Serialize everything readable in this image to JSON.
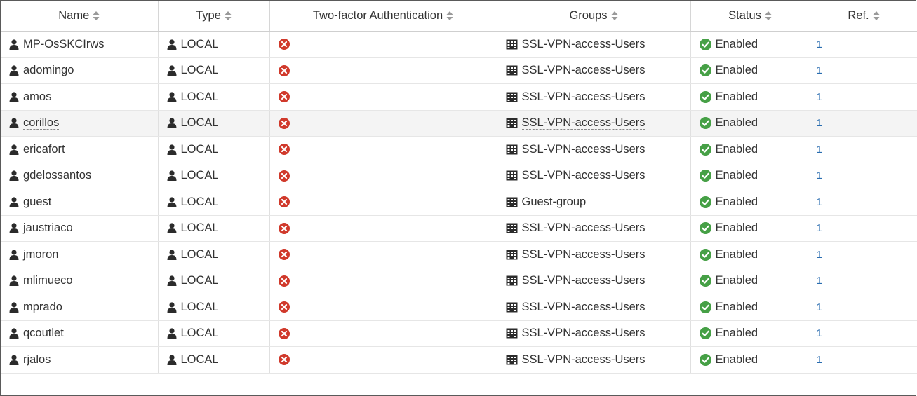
{
  "columns": [
    {
      "label": "Name"
    },
    {
      "label": "Type"
    },
    {
      "label": "Two-factor Authentication"
    },
    {
      "label": "Groups"
    },
    {
      "label": "Status"
    },
    {
      "label": "Ref."
    }
  ],
  "icons": {
    "user": "user-icon",
    "tfa_disabled": "x-circle-icon",
    "group": "group-icon",
    "enabled": "check-circle-icon"
  },
  "colors": {
    "error": "#d0392b",
    "success": "#46a046",
    "link": "#2a6db0"
  },
  "rows": [
    {
      "name": "MP-OsSKCIrws",
      "type": "LOCAL",
      "group": "SSL-VPN-access-Users",
      "status": "Enabled",
      "ref": "1"
    },
    {
      "name": "adomingo",
      "type": "LOCAL",
      "group": "SSL-VPN-access-Users",
      "status": "Enabled",
      "ref": "1"
    },
    {
      "name": "amos",
      "type": "LOCAL",
      "group": "SSL-VPN-access-Users",
      "status": "Enabled",
      "ref": "1"
    },
    {
      "name": "corillos",
      "type": "LOCAL",
      "group": "SSL-VPN-access-Users",
      "status": "Enabled",
      "ref": "1"
    },
    {
      "name": "ericafort",
      "type": "LOCAL",
      "group": "SSL-VPN-access-Users",
      "status": "Enabled",
      "ref": "1"
    },
    {
      "name": "gdelossantos",
      "type": "LOCAL",
      "group": "SSL-VPN-access-Users",
      "status": "Enabled",
      "ref": "1"
    },
    {
      "name": "guest",
      "type": "LOCAL",
      "group": "Guest-group",
      "status": "Enabled",
      "ref": "1"
    },
    {
      "name": "jaustriaco",
      "type": "LOCAL",
      "group": "SSL-VPN-access-Users",
      "status": "Enabled",
      "ref": "1"
    },
    {
      "name": "jmoron",
      "type": "LOCAL",
      "group": "SSL-VPN-access-Users",
      "status": "Enabled",
      "ref": "1"
    },
    {
      "name": "mlimueco",
      "type": "LOCAL",
      "group": "SSL-VPN-access-Users",
      "status": "Enabled",
      "ref": "1"
    },
    {
      "name": "mprado",
      "type": "LOCAL",
      "group": "SSL-VPN-access-Users",
      "status": "Enabled",
      "ref": "1"
    },
    {
      "name": "qcoutlet",
      "type": "LOCAL",
      "group": "SSL-VPN-access-Users",
      "status": "Enabled",
      "ref": "1"
    },
    {
      "name": "rjalos",
      "type": "LOCAL",
      "group": "SSL-VPN-access-Users",
      "status": "Enabled",
      "ref": "1"
    }
  ]
}
